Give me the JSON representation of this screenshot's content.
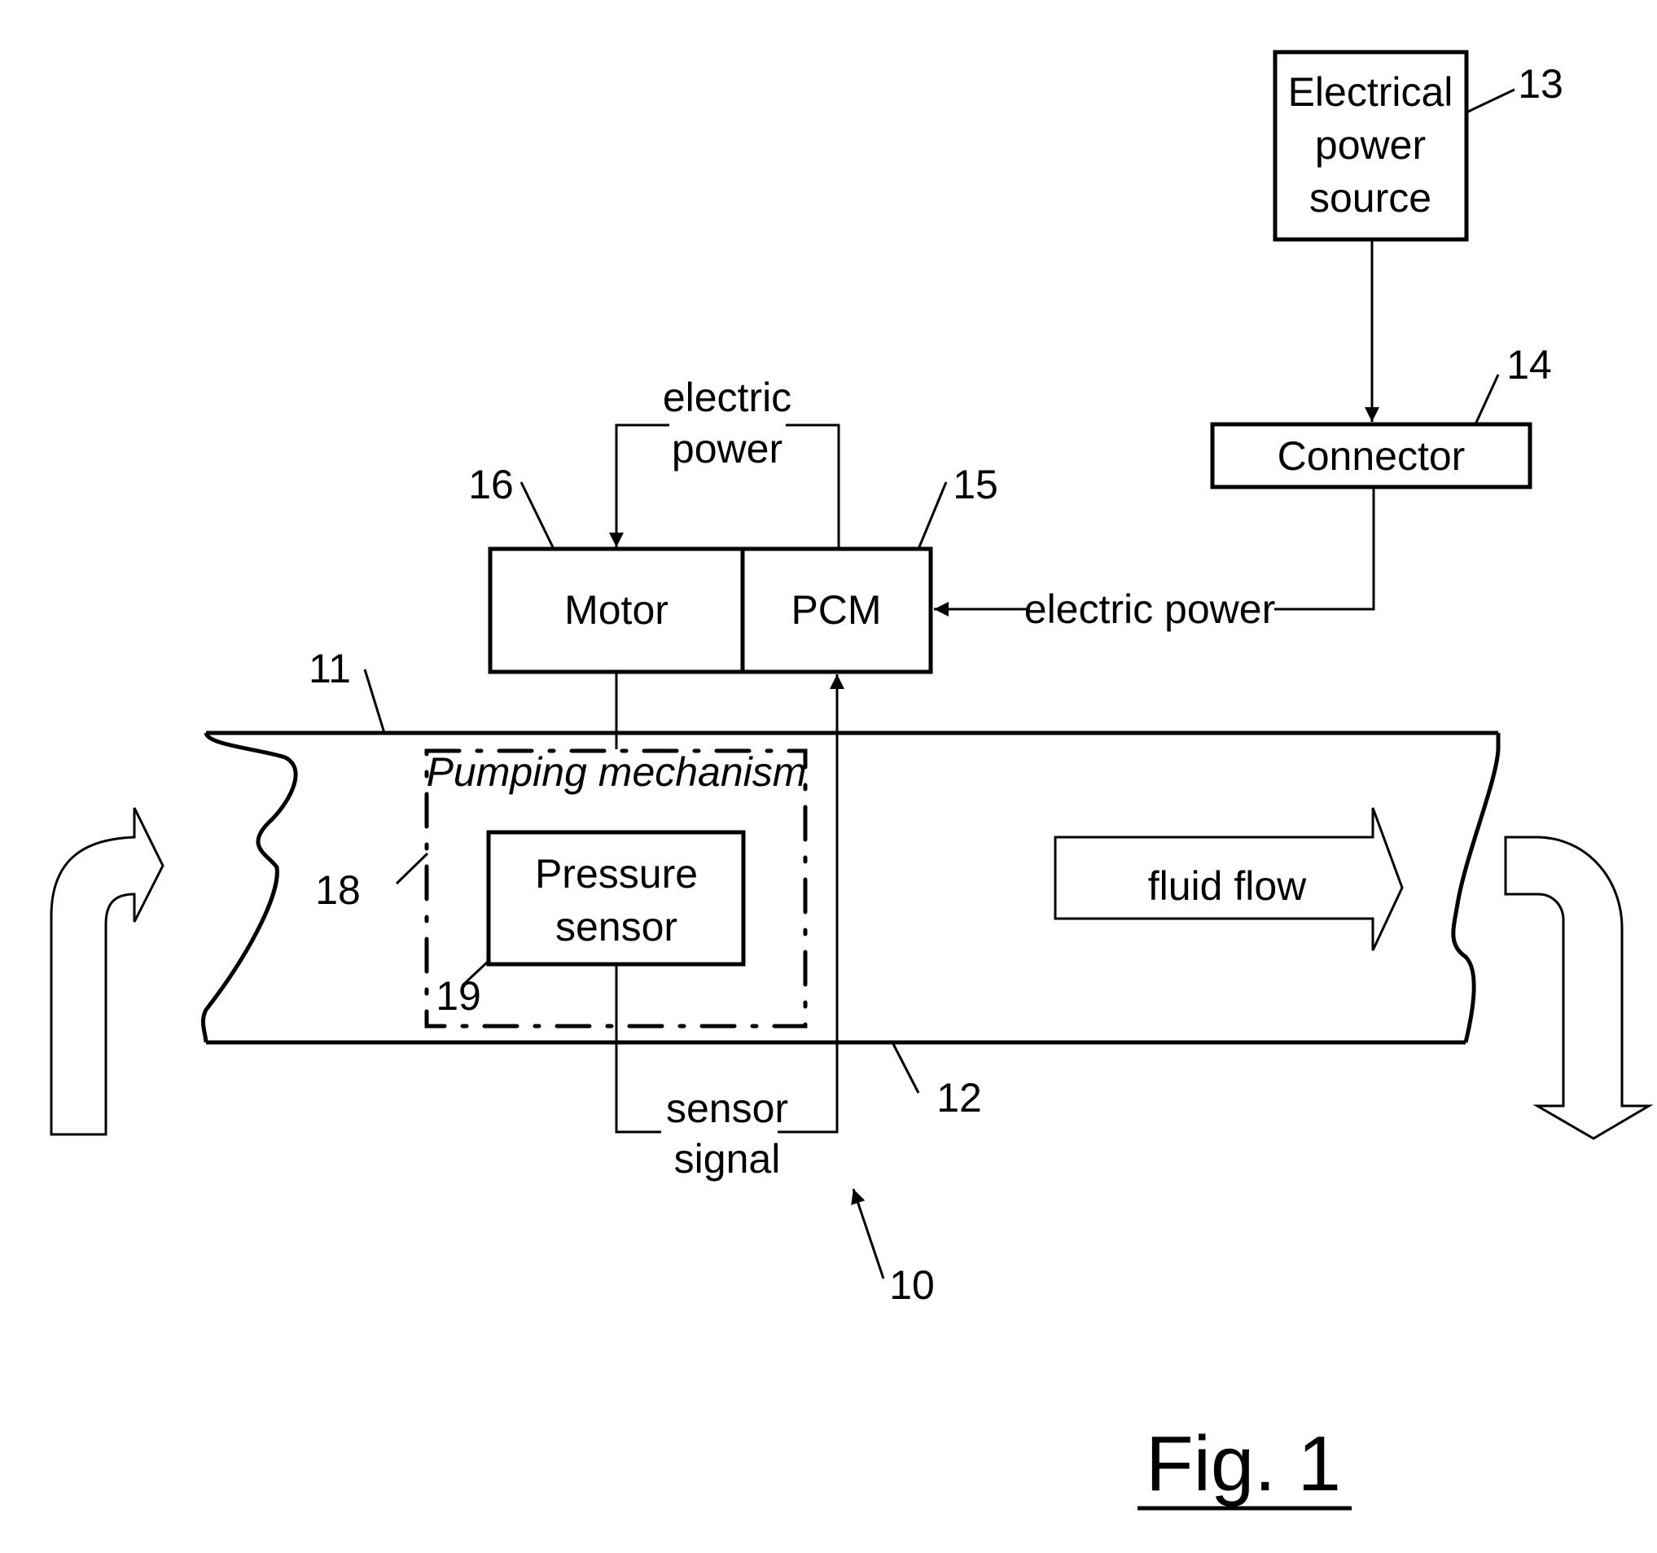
{
  "figure": {
    "caption": "Fig. 1",
    "colors": {
      "ink": "#000000",
      "paper": "#ffffff"
    }
  },
  "blocks": {
    "power_source": {
      "lines": [
        "Electrical",
        "power",
        "source"
      ],
      "ref": "13"
    },
    "connector": {
      "label": "Connector",
      "ref": "14"
    },
    "pcm": {
      "label": "PCM",
      "ref": "15"
    },
    "motor": {
      "label": "Motor",
      "ref": "16"
    },
    "pumping_mechanism": {
      "label": "Pumping mechanism",
      "ref": "18"
    },
    "pressure_sensor": {
      "lines": [
        "Pressure",
        "sensor"
      ],
      "ref": "19"
    }
  },
  "pipe": {
    "upper_wall_ref": "11",
    "lower_wall_ref": "12",
    "system_ref": "10"
  },
  "signals": {
    "pcm_to_motor": [
      "electric",
      "power"
    ],
    "connector_to_pcm": "electric power",
    "sensor_to_pcm": [
      "sensor",
      "signal"
    ]
  },
  "flow": {
    "label": "fluid flow"
  }
}
